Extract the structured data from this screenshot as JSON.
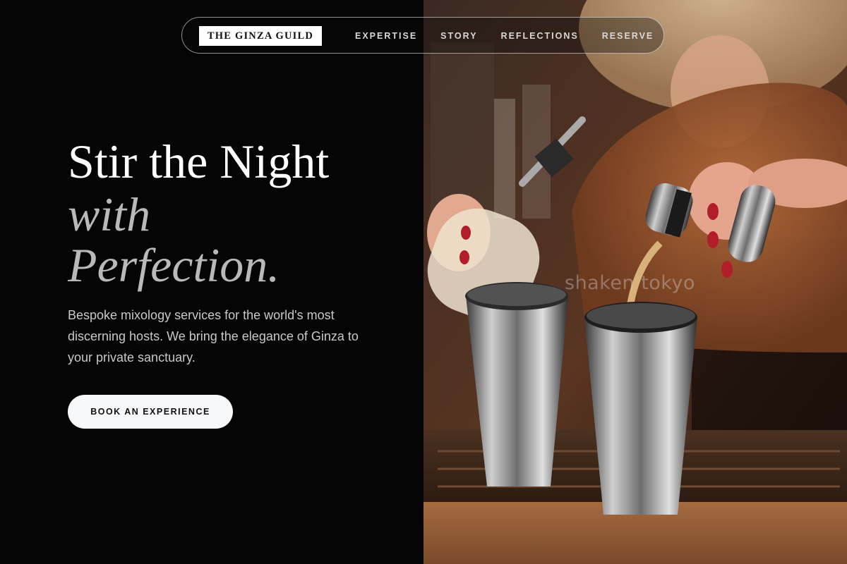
{
  "nav": {
    "brand": "THE GINZA GUILD",
    "links": [
      "EXPERTISE",
      "STORY",
      "REFLECTIONS",
      "RESERVE"
    ]
  },
  "hero": {
    "headline_line1": "Stir the Night",
    "headline_line2": "with",
    "headline_line3": "Perfection.",
    "tagline": "Bespoke mixology services for the world's most discerning hosts. We bring the elegance of Ginza to your private sanctuary.",
    "cta_label": "BOOK AN EXPERIENCE"
  },
  "photo": {
    "watermark": "shaken tokyo",
    "subject": "bartender pouring from jigger into metal shakers"
  },
  "colors": {
    "background": "#050505",
    "headline": "#ffffff",
    "headline_italic": "#b9b9b9",
    "body_text": "#c9c9c9",
    "cta_bg": "#f7f8fa"
  }
}
